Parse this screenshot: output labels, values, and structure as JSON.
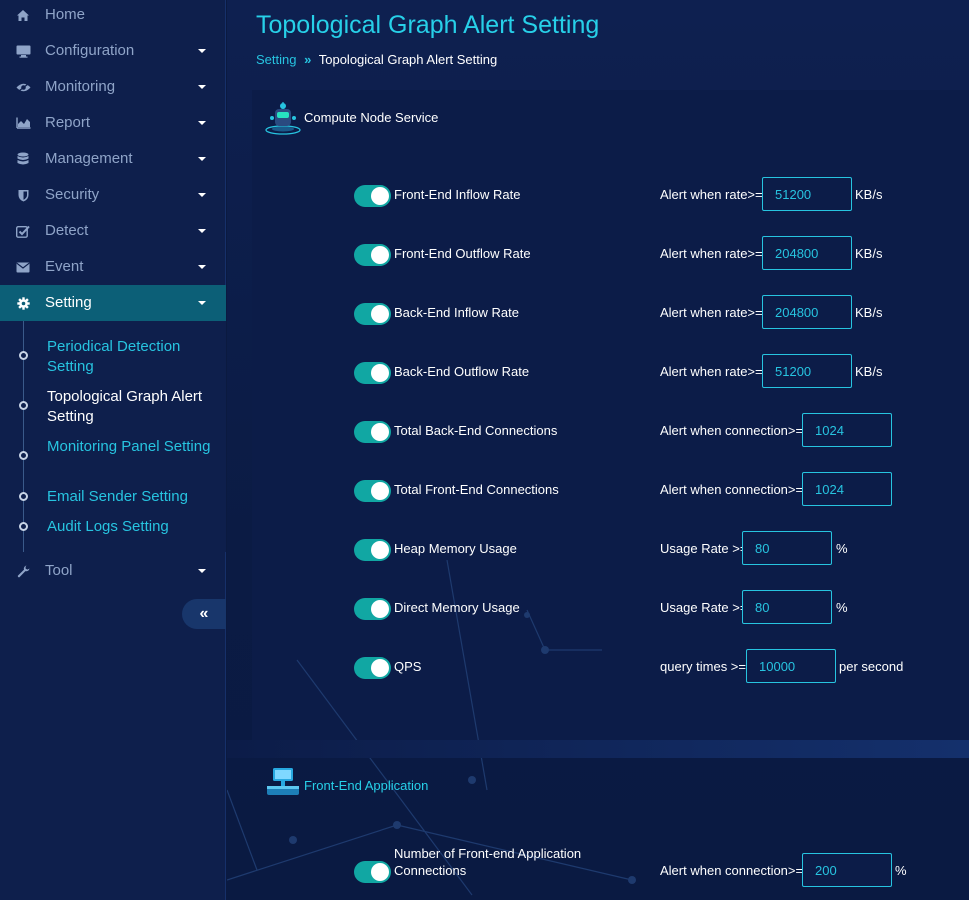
{
  "sidebar": {
    "items": [
      {
        "label": "Home",
        "icon": "home-icon"
      },
      {
        "label": "Configuration",
        "icon": "monitor-icon"
      },
      {
        "label": "Monitoring",
        "icon": "eye-icon"
      },
      {
        "label": "Report",
        "icon": "area-chart-icon"
      },
      {
        "label": "Management",
        "icon": "database-icon"
      },
      {
        "label": "Security",
        "icon": "shield-icon"
      },
      {
        "label": "Detect",
        "icon": "checkbox-icon"
      },
      {
        "label": "Event",
        "icon": "envelope-icon"
      },
      {
        "label": "Setting",
        "icon": "gear-icon"
      },
      {
        "label": "Tool",
        "icon": "wrench-icon"
      }
    ],
    "submenu": [
      {
        "label": "Periodical Detection Setting"
      },
      {
        "label": "Topological Graph Alert Setting"
      },
      {
        "label": "Monitoring Panel Setting"
      },
      {
        "label": "Email Sender Setting"
      },
      {
        "label": "Audit Logs Setting"
      }
    ],
    "collapse_glyph": "«"
  },
  "header": {
    "title": "Topological Graph Alert Setting",
    "breadcrumb": {
      "root": "Setting",
      "separator": "»",
      "current": "Topological Graph Alert Setting"
    }
  },
  "sections": {
    "compute": {
      "title": "Compute Node Service",
      "rows": [
        {
          "label": "Front-End Inflow Rate",
          "condition": "Alert when rate>=",
          "value": "51200",
          "unit": "KB/s",
          "enabled": true
        },
        {
          "label": "Front-End Outflow Rate",
          "condition": "Alert when rate>=",
          "value": "204800",
          "unit": "KB/s",
          "enabled": true
        },
        {
          "label": "Back-End Inflow Rate",
          "condition": "Alert when rate>=",
          "value": "204800",
          "unit": "KB/s",
          "enabled": true
        },
        {
          "label": "Back-End Outflow Rate",
          "condition": "Alert when rate>=",
          "value": "51200",
          "unit": "KB/s",
          "enabled": true
        },
        {
          "label": "Total Back-End Connections",
          "condition": "Alert when connection>=",
          "value": "1024",
          "unit": "",
          "enabled": true
        },
        {
          "label": "Total Front-End Connections",
          "condition": "Alert when connection>=",
          "value": "1024",
          "unit": "",
          "enabled": true
        },
        {
          "label": "Heap Memory Usage",
          "condition": "Usage Rate >=",
          "value": "80",
          "unit": "%",
          "enabled": true
        },
        {
          "label": "Direct Memory Usage",
          "condition": "Usage Rate >=",
          "value": "80",
          "unit": "%",
          "enabled": true
        },
        {
          "label": "QPS",
          "condition": "query times >=",
          "value": "10000",
          "unit": "per second",
          "enabled": true
        }
      ]
    },
    "frontend": {
      "title": "Front-End Application",
      "rows": [
        {
          "label_line1": "Number of Front-end Application",
          "label_line2": "Connections",
          "condition": "Alert when connection>=",
          "value": "200",
          "unit": "%",
          "enabled": true
        }
      ]
    }
  },
  "colors": {
    "accent": "#27c4e0",
    "toggle_on": "#11a7a3",
    "active_nav": "#0c5f77",
    "background": "#0b1a40"
  }
}
